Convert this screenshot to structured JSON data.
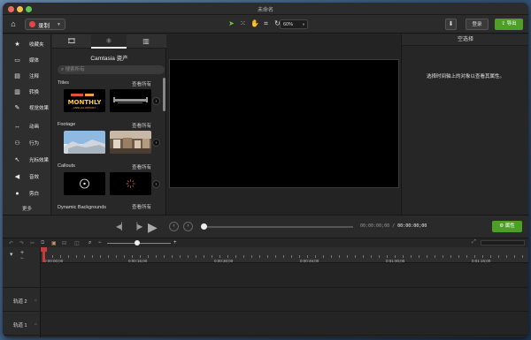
{
  "window": {
    "title": "未命名"
  },
  "toolbar": {
    "record_label": "录制",
    "zoom_value": "60%",
    "login_label": "登录",
    "export_label": "导出"
  },
  "nav": {
    "items": [
      {
        "label": "收藏夹",
        "icon": "★"
      },
      {
        "label": "媒体",
        "icon": "▭"
      },
      {
        "label": "注释",
        "icon": "▤"
      },
      {
        "label": "转换",
        "icon": "▥"
      },
      {
        "label": "视觉效果",
        "icon": "✎"
      },
      {
        "label": "动画",
        "icon": "↔"
      },
      {
        "label": "行为",
        "icon": "⚇"
      },
      {
        "label": "光标效果",
        "icon": "↖"
      },
      {
        "label": "音效",
        "icon": "◀"
      },
      {
        "label": "旁白",
        "icon": "●"
      }
    ],
    "more_label": "更多"
  },
  "library": {
    "title": "Camtasia 资产",
    "search_placeholder": "搜索所有",
    "see_all": "查看所有",
    "sections": [
      {
        "title": "Titles",
        "thumb1_text": "MONTHLY",
        "thumb1_sub": "ANNUAL REPORT"
      },
      {
        "title": "Footage"
      },
      {
        "title": "Callouts"
      },
      {
        "title": "Dynamic Backgrounds"
      }
    ]
  },
  "properties": {
    "title": "空选择",
    "message": "选择时间轴上的对象以查看其属性。",
    "button_label": "属性"
  },
  "playback": {
    "time_prefix": "00:00:00;00",
    "time_sep": "/",
    "time_total": "00:00:00;00"
  },
  "timeline": {
    "ruler_labels": [
      "0:00:00;00",
      "0:00:15;00",
      "0:00:30;00",
      "0:00:45;00",
      "0:01:00;00",
      "0:01:15;00"
    ],
    "tracks": [
      "轨道 2",
      "轨道 1"
    ]
  }
}
